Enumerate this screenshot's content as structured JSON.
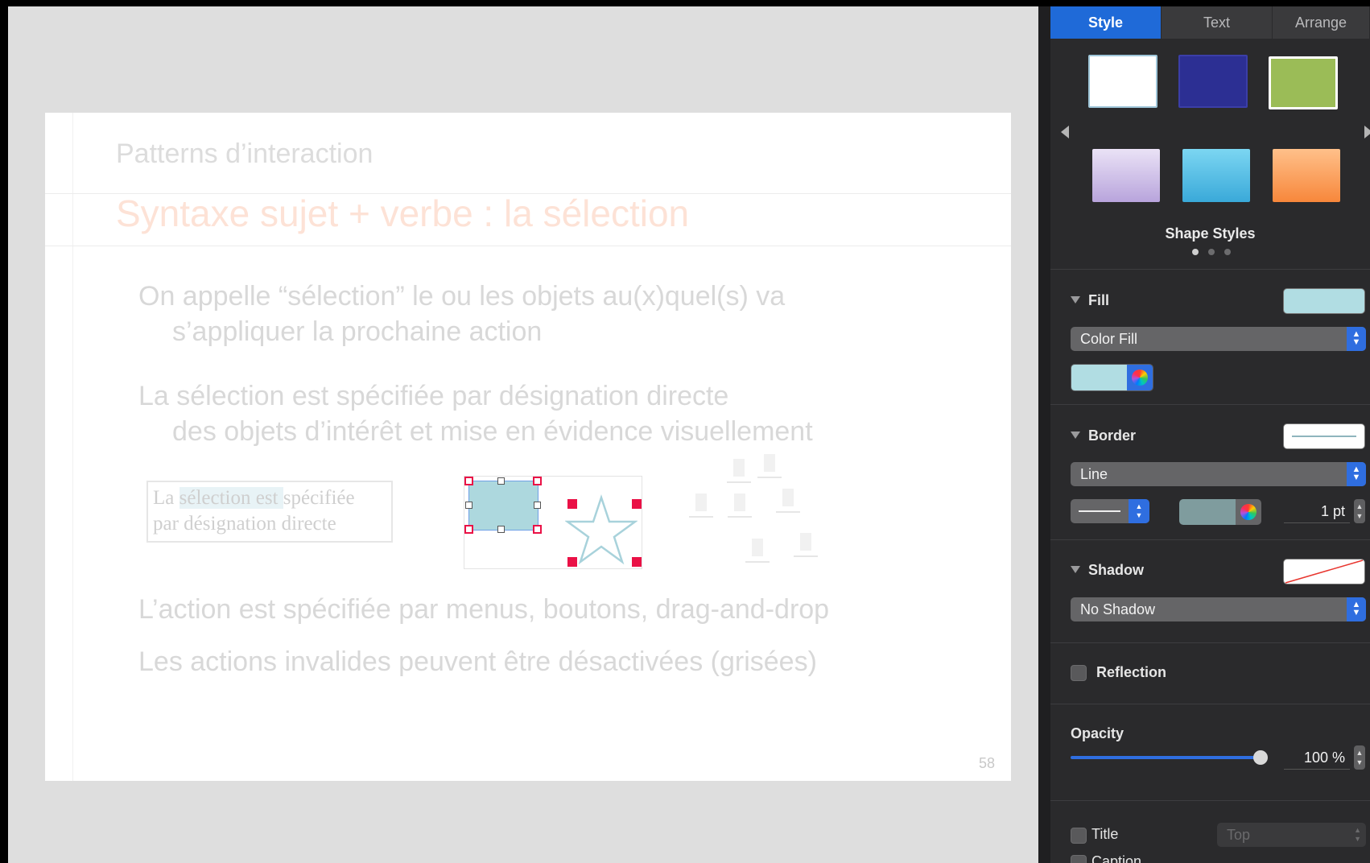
{
  "slide": {
    "header": "Patterns d’interaction",
    "title": "Syntaxe sujet + verbe : la sélection",
    "bullets": [
      {
        "line1": "On appelle “sélection” le ou les objets au(x)quel(s) va",
        "line2": "s’appliquer la prochaine action"
      },
      {
        "line1": "La sélection est spécifiée par désignation directe",
        "line2": "des objets d’intérêt et mise en évidence visuellement"
      },
      {
        "line1": "L’action est spécifiée par menus, boutons, drag-and-drop"
      },
      {
        "line1": "Les actions invalides peuvent être désactivées (grisées)"
      }
    ],
    "text_demo": {
      "pre": "La ",
      "highlight": "sélection est ",
      "post": "spécifiée",
      "line2": "par désignation directe"
    },
    "page_number": "58"
  },
  "inspector": {
    "tabs": [
      {
        "label": "Style",
        "active": true
      },
      {
        "label": "Text",
        "active": false
      },
      {
        "label": "Arrange",
        "active": false
      }
    ],
    "shape_styles_label": "Shape Styles",
    "fill": {
      "label": "Fill",
      "type": "Color Fill",
      "color": "#b1dde3"
    },
    "border": {
      "label": "Border",
      "type": "Line",
      "color": "#7f9c9e",
      "width": "1 pt"
    },
    "shadow": {
      "label": "Shadow",
      "type": "No Shadow"
    },
    "reflection": {
      "label": "Reflection",
      "checked": false
    },
    "opacity": {
      "label": "Opacity",
      "value": "100 %",
      "fraction": 1.0
    },
    "title": {
      "label": "Title",
      "checked": false,
      "position": "Top"
    },
    "caption": {
      "label": "Caption",
      "checked": false
    }
  },
  "colors": {
    "accent": "#1f6ad8",
    "selection_handle": "#ea1146",
    "shape_fill": "#add8de"
  }
}
